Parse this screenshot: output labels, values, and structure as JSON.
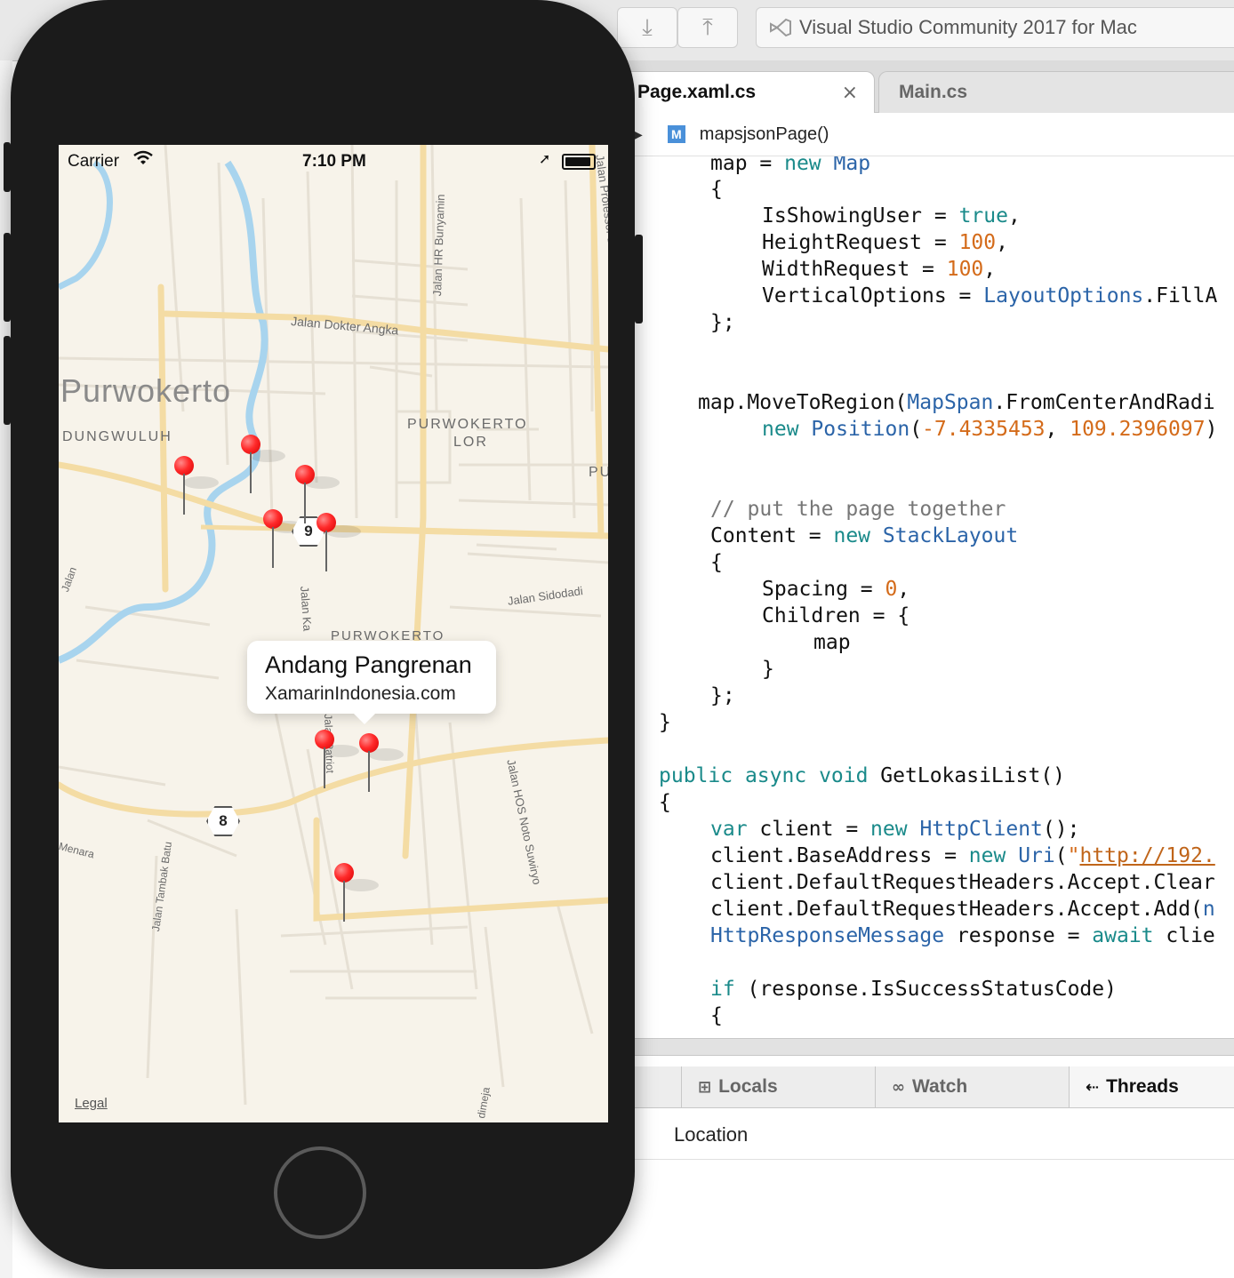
{
  "ide": {
    "status_text": "Visual Studio Community 2017 for Mac",
    "tabs": [
      {
        "label": "Page.xaml.cs",
        "close": "×"
      },
      {
        "label": "Main.cs"
      }
    ],
    "breadcrumb": {
      "badge": "M",
      "method": "mapsjsonPage()"
    },
    "debug_pads": {
      "tabs": [
        {
          "icon": "⊞",
          "label": "Locals"
        },
        {
          "icon": "∞",
          "label": "Watch"
        },
        {
          "icon": "⇠",
          "label": "Threads"
        }
      ],
      "column_header": "Location"
    }
  },
  "phone": {
    "status": {
      "carrier": "Carrier",
      "time": "7:10 PM"
    },
    "map": {
      "labels": {
        "city": "Purwokerto",
        "dungwuluh": "DUNGWULUH",
        "pwt_lor_1": "PURWOKERTO",
        "pwt_lor_2": "LOR",
        "pwt_kidul": "PURWOKERTO",
        "pu": "PU",
        "road_dokter_angka": "Jalan Dokter Angka",
        "road_hr_bunyamin": "Jalan HR Bunyamin",
        "road_professor": "Jalan Professor Doktor Soeparno",
        "road_sidodadi": "Jalan Sidodadi",
        "road_hos": "Jalan HOS Noto Suwiryo",
        "road_tambak": "Jalan Tambak Batu",
        "road_menara": "Menara",
        "road_patriot": "Jalan Patriot",
        "road_ka": "Jalan Ka",
        "road_dimeja": "dimeja",
        "road_jalan_left": "Jalan",
        "shield_9": "9",
        "shield_8": "8"
      },
      "callout": {
        "title": "Andang Pangrenan",
        "subtitle": "XamarinIndonesia.com"
      },
      "legal": "Legal"
    }
  }
}
